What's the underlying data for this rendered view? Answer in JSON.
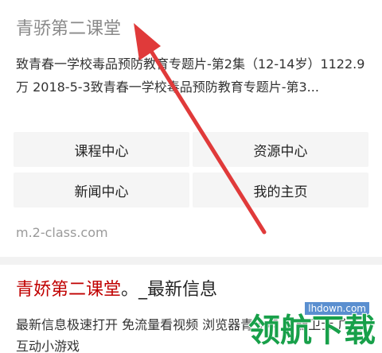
{
  "result1": {
    "title": "青骄第二课堂",
    "snippet": "致青春一学校毒品预防教育专题片-第2集（12-14岁）1122.9万 2018-5-3致青春一学校毒品预防教育专题片-第3...",
    "links": [
      "课程中心",
      "资源中心",
      "新闻中心",
      "我的主页"
    ],
    "source": "m.2-class.com"
  },
  "result2": {
    "title_highlight": "青娇第二课堂",
    "title_rest": "。_最新信息",
    "snippet": "最新信息极速打开 免流量看视频 浏览器青少年 智能卫士 广告 互动小游戏"
  },
  "watermark": {
    "site": "lhdown.com",
    "text": "领航下载"
  },
  "colors": {
    "title_highlight": "#c00000",
    "arrow": "#e03a3a",
    "watermark": "#18a04a"
  }
}
